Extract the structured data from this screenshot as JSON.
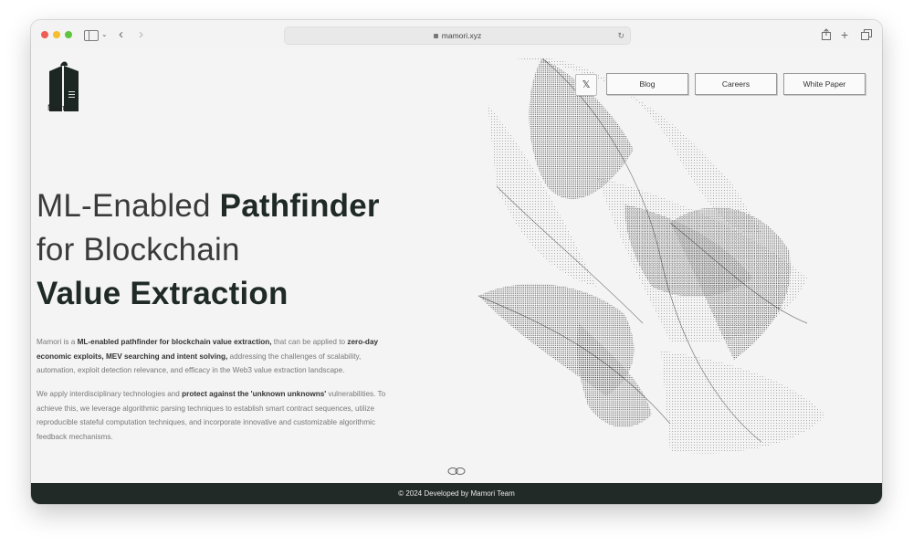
{
  "browser": {
    "url": "mamori.xyz"
  },
  "brand": {
    "name": "Mamori"
  },
  "nav": {
    "x_label": "𝕏",
    "blog": "Blog",
    "careers": "Careers",
    "white_paper": "White Paper"
  },
  "hero": {
    "line1_light": "ML-Enabled ",
    "line1_bold": "Pathfinder",
    "line2": "for Blockchain",
    "line3_bold": "Value Extraction"
  },
  "para1": {
    "t1": "Mamori is a ",
    "b1": "ML-enabled pathfinder for blockchain value extraction,",
    "t2": " that can be applied to ",
    "b2": "zero-day economic exploits, MEV searching and intent solving,",
    "t3": " addressing the challenges of scalability, automation, exploit detection relevance, and efficacy in the Web3 value extraction landscape."
  },
  "para2": {
    "t1": "We apply interdisciplinary technologies and ",
    "b1": "protect against the 'unknown unknowns'",
    "t2": " vulnerabilities. To achieve this, we leverage algorithmic parsing techniques to establish smart contract sequences, utilize reproducible stateful computation techniques, and incorporate innovative and customizable algorithmic feedback mechanisms."
  },
  "footer": {
    "text": "© 2024 Developed by Mamori Team"
  },
  "colors": {
    "footer_bg": "#222a27",
    "accent_dark": "#1f2a26"
  }
}
